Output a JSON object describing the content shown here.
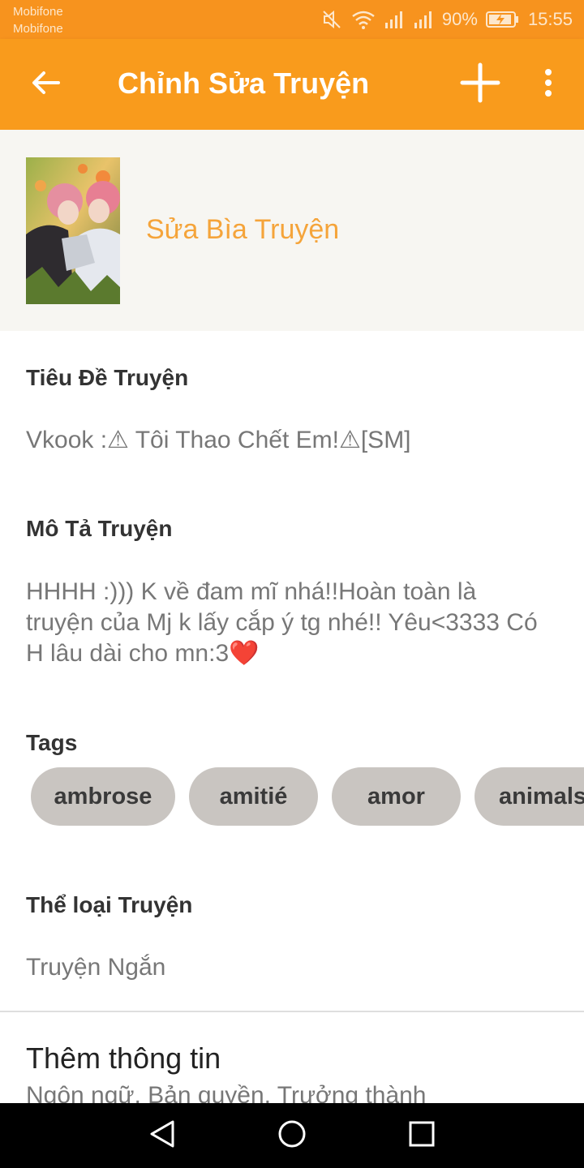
{
  "status_bar": {
    "carrier_1": "Mobifone",
    "carrier_2": "Mobifone",
    "battery_percent": "90%",
    "time": "15:55",
    "icons": [
      "mute-icon",
      "wifi-icon",
      "signal-icon",
      "signal-icon",
      "battery-charging-icon"
    ]
  },
  "app_bar": {
    "title": "Chỉnh Sửa Truyện",
    "back_icon": "arrow-back-icon",
    "add_icon": "plus-icon",
    "more_icon": "more-vertical-icon",
    "color": "#f99b1c"
  },
  "cover": {
    "edit_label": "Sửa Bìa Truyện",
    "accent_color": "#f5a43a"
  },
  "story_title": {
    "label": "Tiêu Đề Truyện",
    "value": "Vkook :⚠ Tôi Thao Chết Em!⚠[SM]"
  },
  "description": {
    "label": "Mô Tả Truyện",
    "value": "HHHH :))) K về đam mĩ nhá!!Hoàn toàn là truyện của Mj k lấy cắp ý tg nhé!! Yêu<3333 Có H lâu dài cho mn:3❤️"
  },
  "tags": {
    "label": "Tags",
    "items": [
      "ambrose",
      "amitié",
      "amor",
      "animals"
    ]
  },
  "category": {
    "label": "Thể loại Truyện",
    "value": "Truyện Ngắn"
  },
  "more_info": {
    "title": "Thêm thông tin",
    "subtitle": "Ngôn ngữ, Bản quyền, Trưởng thành"
  },
  "nav_bar": {
    "back_icon": "nav-back-icon",
    "home_icon": "nav-home-icon",
    "recents_icon": "nav-recents-icon"
  }
}
